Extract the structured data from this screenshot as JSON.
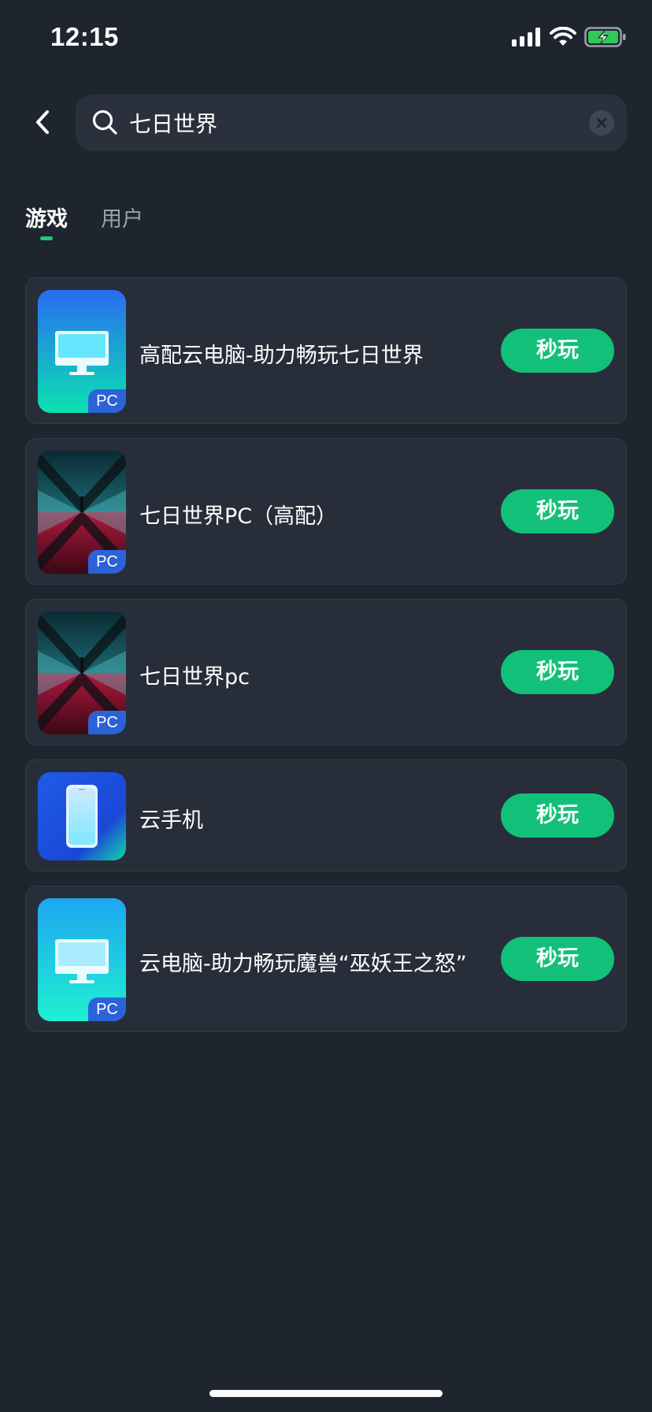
{
  "status_bar": {
    "time": "12:15"
  },
  "search": {
    "value": "七日世界",
    "placeholder": ""
  },
  "tabs": [
    {
      "label": "游戏",
      "active": true
    },
    {
      "label": "用户",
      "active": false
    }
  ],
  "games": [
    {
      "title": "高配云电脑-助力畅玩七日世界",
      "badge": "PC",
      "action": "秒玩",
      "icon": "desktop-monitor-icon"
    },
    {
      "title": "七日世界PC（高配）",
      "badge": "PC",
      "action": "秒玩",
      "icon": "once-human-cover-icon"
    },
    {
      "title": "七日世界pc",
      "badge": "PC",
      "action": "秒玩",
      "icon": "once-human-cover-icon"
    },
    {
      "title": "云手机",
      "action": "秒玩",
      "icon": "cloud-phone-icon"
    },
    {
      "title": "云电脑-助力畅玩魔兽“巫妖王之怒”",
      "badge": "PC",
      "action": "秒玩",
      "icon": "desktop-monitor-icon"
    }
  ],
  "colors": {
    "background": "#1f252f",
    "card": "#272e39",
    "accent_green": "#12c07a",
    "badge_blue": "#2c62d8"
  }
}
